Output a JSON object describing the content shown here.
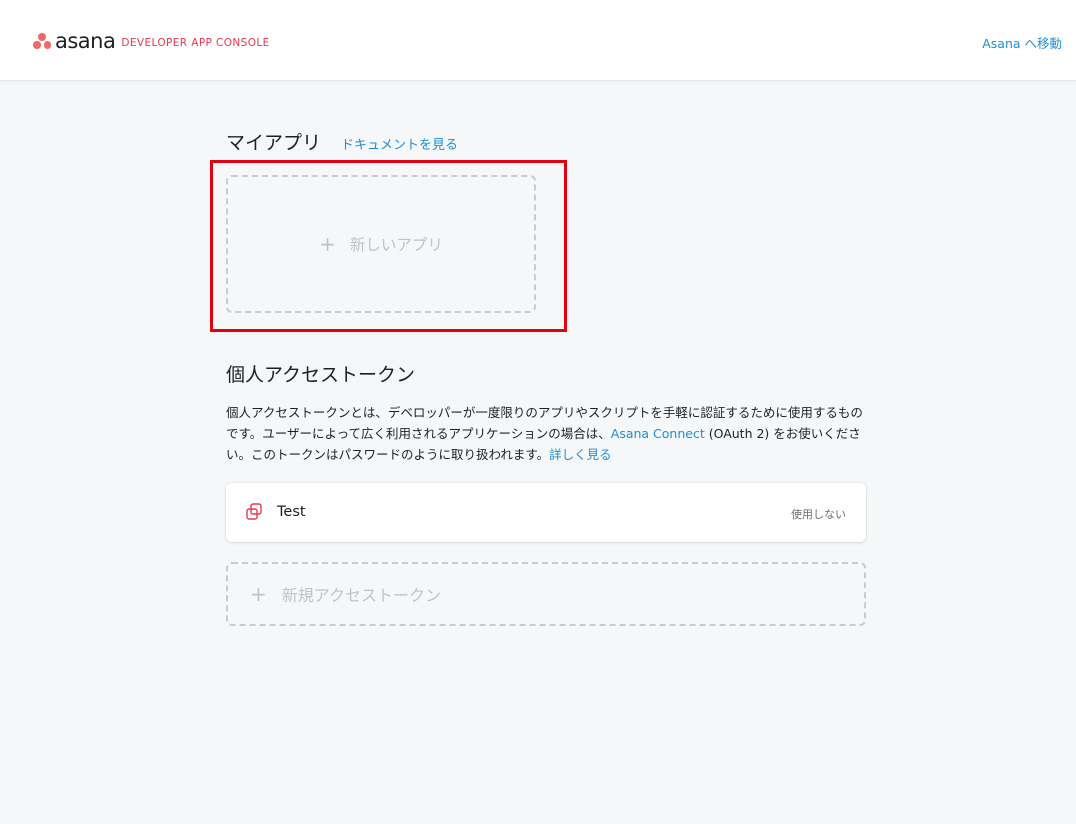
{
  "header": {
    "logo_text": "asana",
    "logo_sub": "DEVELOPER APP CONSOLE",
    "goto_asana": "Asana へ移動"
  },
  "my_apps": {
    "title": "マイアプリ",
    "docs_link": "ドキュメントを見る",
    "new_app_plus": "+",
    "new_app_label": "新しいアプリ"
  },
  "pat": {
    "title": "個人アクセストークン",
    "desc_part1": "個人アクセストークンとは、デベロッパーが一度限りのアプリやスクリプトを手軽に認証するために使用するものです。ユーザーによって広く利用されるアプリケーションの場合は、",
    "desc_link1": "Asana Connect",
    "desc_part2": " (OAuth 2) をお使いください。このトークンはパスワードのように取り扱われます。",
    "desc_link2": "詳しく見る",
    "tokens": [
      {
        "name": "Test",
        "status": "使用しない"
      }
    ],
    "new_token_plus": "+",
    "new_token_label": "新規アクセストークン"
  },
  "colors": {
    "accent_link": "#1f8ed6",
    "brand_coral": "#f06a6a",
    "highlight_red": "#e3000f"
  }
}
